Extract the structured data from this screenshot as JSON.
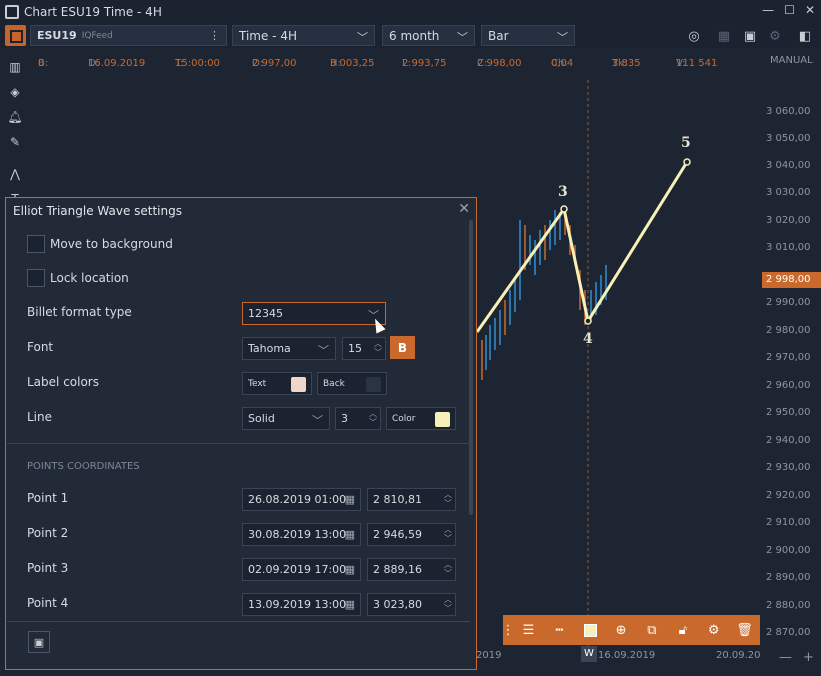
{
  "window": {
    "title": "Chart ESU19 Time - 4H",
    "min": "—",
    "max": "☐",
    "close": "✕"
  },
  "toolbar": {
    "symbol": "ESU19",
    "feed": "IQFeed",
    "timeframe": "Time - 4H",
    "period": "6 month",
    "chart_type": "Bar"
  },
  "infobar": {
    "b_label": "B:",
    "b_val": "0",
    "d_label": "D:",
    "d_val": "16.09.2019",
    "t_label": "T:",
    "t_val": "15:00:00",
    "o_label": "O:",
    "o_val": "2 997,00",
    "h_label": "H:",
    "h_val": "3 003,25",
    "l_label": "L:",
    "l_val": "2 993,75",
    "c_label": "C:",
    "c_val": "2 998,00",
    "ch_label": "Ch:",
    "ch_val": "0,04",
    "tk_label": "Tk:",
    "tk_val": "3 835",
    "v_label": "V:",
    "v_val": "111 541"
  },
  "price_scale": {
    "mode": "MANUAL",
    "labels": [
      "3 060,00",
      "3 050,00",
      "3 040,00",
      "3 030,00",
      "3 020,00",
      "3 010,00",
      "3 000,00",
      "2 990,00",
      "2 980,00",
      "2 970,00",
      "2 960,00",
      "2 950,00",
      "2 940,00",
      "2 930,00",
      "2 920,00",
      "2 910,00",
      "2 900,00",
      "2 890,00",
      "2 880,00",
      "2 870,00"
    ],
    "current": "2 998,00"
  },
  "time_scale": {
    "left": "2019",
    "marker": "W",
    "mid": "16.09.2019",
    "right": "20.09.20"
  },
  "zoom": {
    "out": "—",
    "in": "+"
  },
  "wave_labels": [
    "3",
    "4",
    "5"
  ],
  "dialog": {
    "title": "Elliot Triangle Wave settings",
    "close": "✕",
    "move_to_background": "Move to background",
    "lock_location": "Lock location",
    "billet_label": "Billet format type",
    "billet_value": "12345",
    "font_label": "Font",
    "font_value": "Tahoma",
    "font_size": "15",
    "bold": "B",
    "label_colors_label": "Label colors",
    "text_label": "Text",
    "back_label": "Back",
    "text_color": "#f0d6c8",
    "back_color": "#2b3444",
    "line_label": "Line",
    "line_style": "Solid",
    "line_width": "3",
    "color_label": "Color",
    "line_color": "#f7f0b8",
    "section": "POINTS COORDINATES",
    "points": [
      {
        "label": "Point 1",
        "date": "26.08.2019 01:00",
        "price": "2 810,81"
      },
      {
        "label": "Point 2",
        "date": "30.08.2019 13:00",
        "price": "2 946,59"
      },
      {
        "label": "Point 3",
        "date": "02.09.2019 17:00",
        "price": "2 889,16"
      },
      {
        "label": "Point 4",
        "date": "13.09.2019 13:00",
        "price": "3 023,80"
      }
    ]
  },
  "colors": {
    "accent": "#c96a2c",
    "bg": "#1e2532",
    "wave_line": "#f7f0b8"
  }
}
